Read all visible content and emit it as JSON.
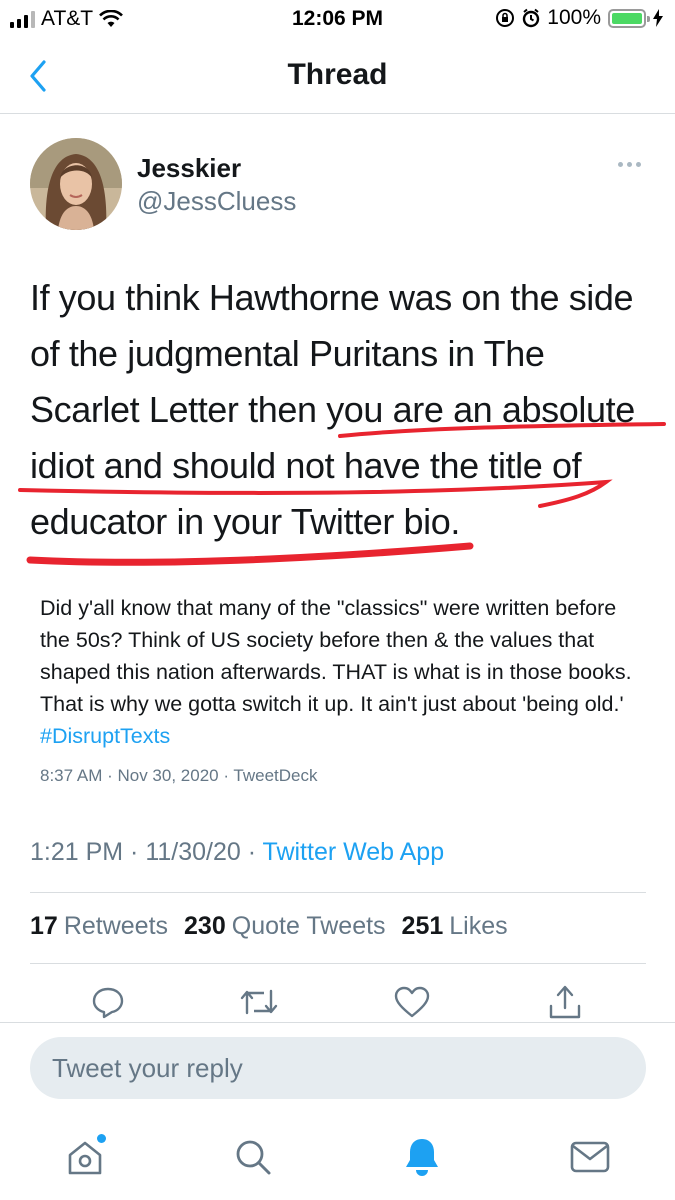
{
  "status_bar": {
    "carrier": "AT&T",
    "time": "12:06 PM",
    "battery_percent": "100%",
    "battery_level": 1.0,
    "icons": [
      "signal-icon",
      "wifi-icon",
      "rotation-lock-icon",
      "alarm-icon",
      "battery-icon",
      "charging-icon"
    ]
  },
  "nav": {
    "title": "Thread",
    "back_icon": "chevron-left-icon"
  },
  "tweet": {
    "display_name": "Jesskier",
    "handle": "@JessCluess",
    "text_before": "If you think Hawthorne was on the side of the judgmental Puritans in The Scarlet Letter then ",
    "text_underlined": "you are an absolute idiot and should not have the title of educator in your Twitter bio.",
    "underline_color": "#e8242f",
    "quote": {
      "text": "Did y'all know that many of the \"classics\" were written before the 50s? Think of US society before then & the values that shaped this nation afterwards. THAT is what is in those books. That is why we gotta switch it up. It ain't just about 'being old.' ",
      "hashtag": "#DisruptTexts",
      "meta": "8:37 AM · Nov 30, 2020 · TweetDeck"
    },
    "meta_time": "1:21 PM · 11/30/20 · ",
    "meta_app": "Twitter Web App",
    "stats": {
      "retweets_count": "17",
      "retweets_label": "Retweets",
      "quotes_count": "230",
      "quotes_label": "Quote Tweets",
      "likes_count": "251",
      "likes_label": "Likes"
    }
  },
  "actions": {
    "reply_icon": "reply-icon",
    "retweet_icon": "retweet-icon",
    "like_icon": "heart-icon",
    "share_icon": "share-icon"
  },
  "reply_box": {
    "placeholder": "Tweet your reply"
  },
  "tab_bar": {
    "items": [
      "home-icon",
      "search-icon",
      "notifications-icon",
      "messages-icon"
    ],
    "active": "notifications-icon"
  },
  "colors": {
    "accent": "#1da1f2",
    "secondary_text": "#657786",
    "primary_text": "#14171a",
    "underline": "#e8242f"
  }
}
